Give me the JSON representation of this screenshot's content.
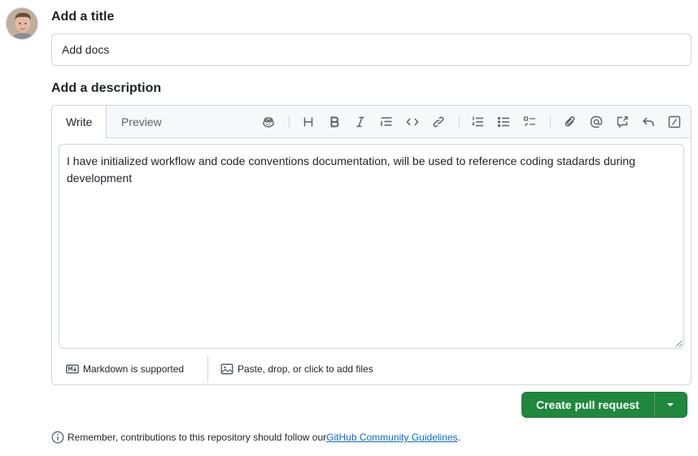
{
  "user": {
    "avatar_icon": "user-avatar"
  },
  "title_section": {
    "label": "Add a title",
    "value": "Add docs"
  },
  "description_section": {
    "label": "Add a description",
    "tabs": [
      {
        "label": "Write",
        "active": true
      },
      {
        "label": "Preview",
        "active": false
      }
    ],
    "toolbar": [
      "copilot-icon",
      "heading-icon",
      "bold-icon",
      "italic-icon",
      "quote-icon",
      "code-icon",
      "link-icon",
      "ordered-list-icon",
      "unordered-list-icon",
      "task-list-icon",
      "attach-icon",
      "mention-icon",
      "cross-reference-icon",
      "saved-replies-icon",
      "slash-commands-icon"
    ],
    "body_text": "I have initialized workflow and code conventions documentation, will be used to reference coding stadards during development",
    "footer": {
      "markdown_label": "Markdown is supported",
      "attach_label": "Paste, drop, or click to add files"
    }
  },
  "actions": {
    "create_label": "Create pull request",
    "dropdown_icon": "caret-down-icon"
  },
  "notice": {
    "prefix": "Remember, contributions to this repository should follow our ",
    "link_text": "GitHub Community Guidelines",
    "suffix": "."
  },
  "colors": {
    "primary_button": "#1f883d",
    "link": "#0969da",
    "border": "#d0d7de"
  }
}
